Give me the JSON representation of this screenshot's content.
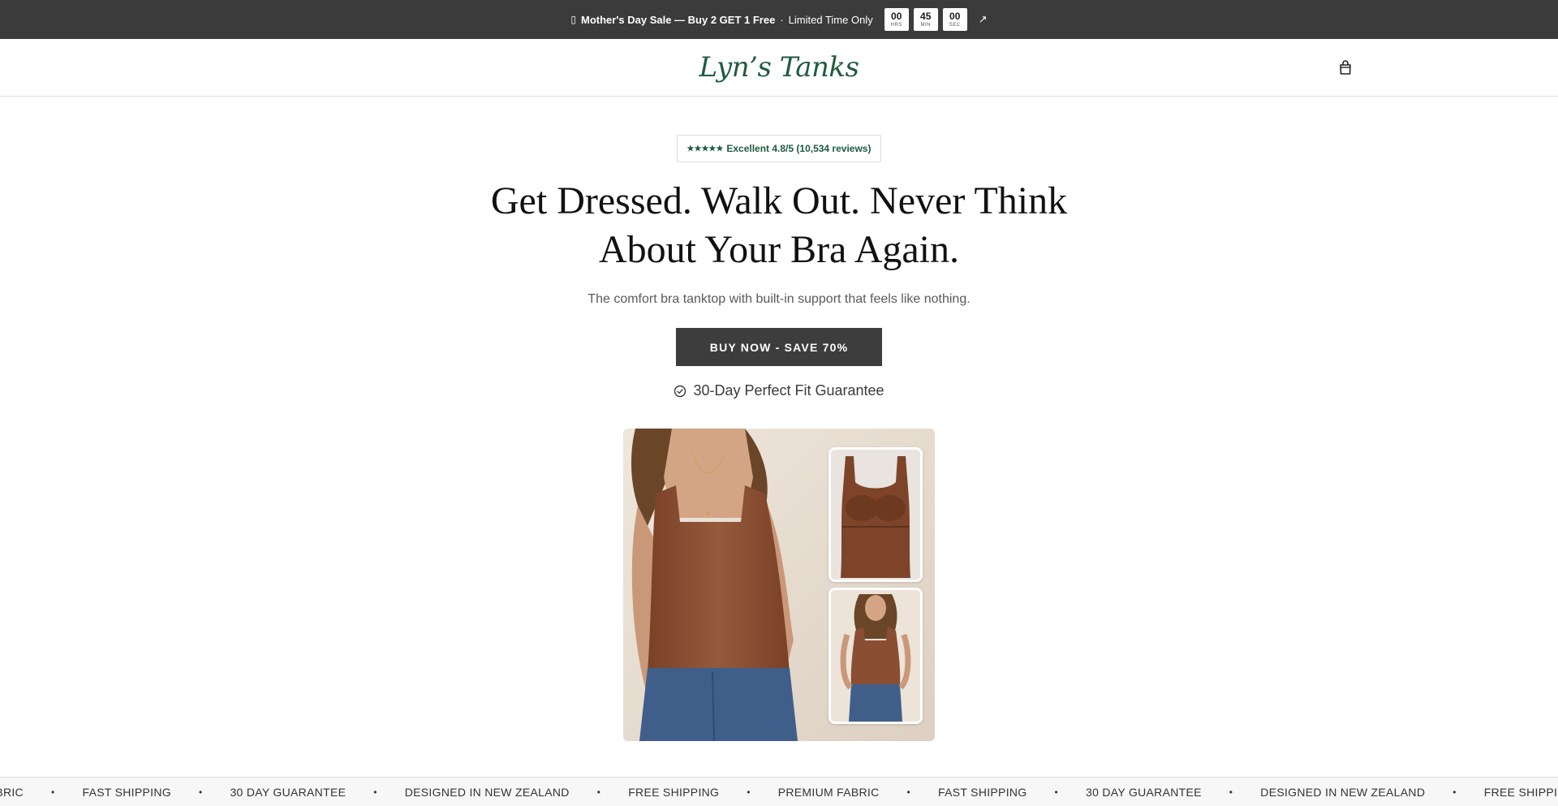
{
  "announcement": {
    "icon": "gift-icon",
    "bold_text": "Mother's Day Sale — Buy 2 GET 1 Free",
    "separator": "·",
    "extra_text": "Limited Time Only",
    "timer": [
      {
        "value": "00",
        "unit": "HRS"
      },
      {
        "value": "45",
        "unit": "MIN"
      },
      {
        "value": "00",
        "unit": "SEC"
      }
    ],
    "link_icon": "arrow-up-right-icon",
    "link_glyph": "↗"
  },
  "header": {
    "logo": "Lyn’s Tanks",
    "cart_icon": "shopping-bag-icon"
  },
  "hero": {
    "rating_badge": {
      "stars": "★★★★★",
      "text": "Excellent 4.8/5 (10,534 reviews)"
    },
    "headline": "Get Dressed. Walk Out. Never Think About Your Bra Again.",
    "subheadline": "The comfort bra tanktop with built-in support that feels like nothing.",
    "cta_label": "BUY NOW - SAVE 70%",
    "guarantee": "30-Day Perfect Fit Guarantee",
    "guarantee_icon": "check-circle-icon"
  },
  "product_image": {
    "description_icon": "product-photo",
    "colors": {
      "tank": "#8a4e33",
      "jeans": "#3f5f8a",
      "background": "#e9dfd5"
    }
  },
  "marquee": {
    "items": [
      "N FABRIC",
      "FAST SHIPPING",
      "30 DAY GUARANTEE",
      "DESIGNED IN NEW ZEALAND",
      "FREE SHIPPING",
      "PREMIUM FABRIC",
      "FAST SHIPPING",
      "30 DAY GUARANTEE",
      "DESIGNED IN NEW ZEALAND",
      "FREE SHIPPI"
    ],
    "separator": "•"
  },
  "colors": {
    "announcement_bg": "#3b3b3b",
    "brand_green": "#1f5b3f",
    "cta_bg": "#3d3d3d"
  }
}
